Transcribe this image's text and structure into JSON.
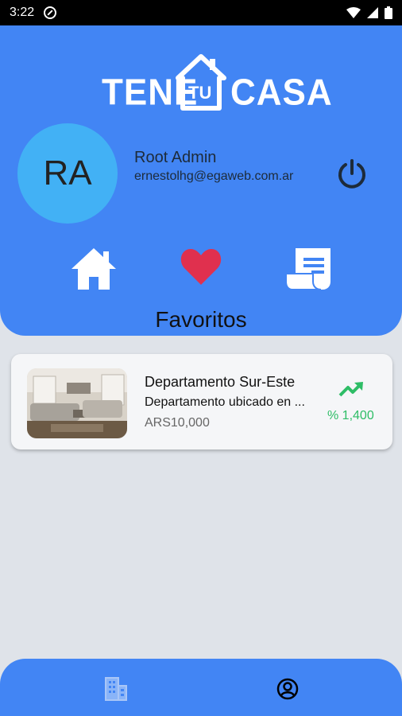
{
  "status_bar": {
    "time": "3:22",
    "icons": [
      "dnd-icon",
      "wifi-icon",
      "signal-icon",
      "battery-icon"
    ]
  },
  "brand": {
    "word_left": "TENE",
    "word_middle": "TU",
    "word_right": "CASA",
    "color": "#ffffff"
  },
  "profile": {
    "initials": "RA",
    "name": "Root Admin",
    "email": "ernestolhg@egaweb.com.ar",
    "avatar_color": "#42b1f5"
  },
  "nav": {
    "items": [
      {
        "icon": "home-icon"
      },
      {
        "icon": "heart-icon",
        "active": true
      },
      {
        "icon": "receipt-icon"
      }
    ]
  },
  "section_title": "Favoritos",
  "favorites": [
    {
      "title": "Departamento Sur-Este",
      "description": "Departamento ubicado en ...",
      "price": "ARS10,000",
      "change": "% 1,400",
      "trend_icon": "trending-up-icon"
    }
  ],
  "bottom_nav": {
    "items": [
      {
        "icon": "building-icon"
      },
      {
        "icon": "account-circle-icon"
      }
    ]
  },
  "colors": {
    "primary": "#4285f4",
    "background": "#dfe3e9",
    "heart": "#e0304e",
    "trend": "#2ebd66"
  }
}
